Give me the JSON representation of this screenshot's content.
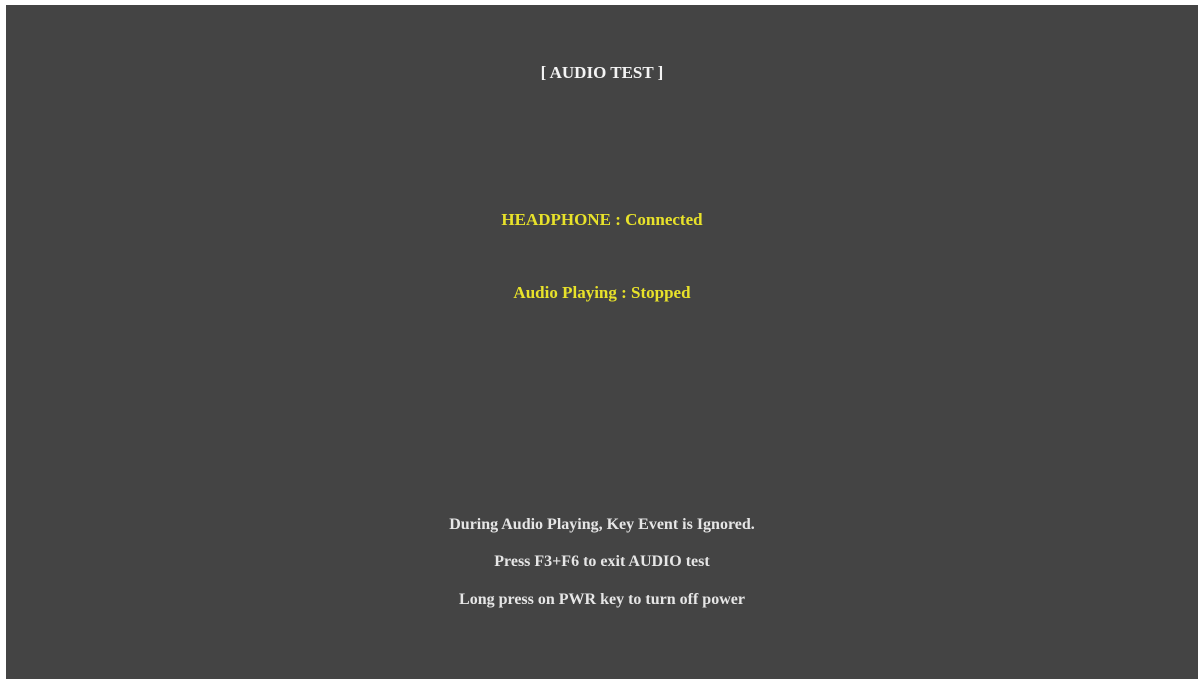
{
  "screen": {
    "title": "[  AUDIO TEST  ]",
    "status": {
      "headphone": "HEADPHONE : Connected",
      "audio_playing": "Audio Playing : Stopped"
    },
    "instructions": [
      "During Audio Playing, Key Event is Ignored.",
      "Press F3+F6 to exit AUDIO test",
      "Long press on PWR key to turn off power"
    ]
  },
  "colors": {
    "background": "#444444",
    "status_text": "#e8e22a",
    "normal_text": "#e6e6e6"
  }
}
